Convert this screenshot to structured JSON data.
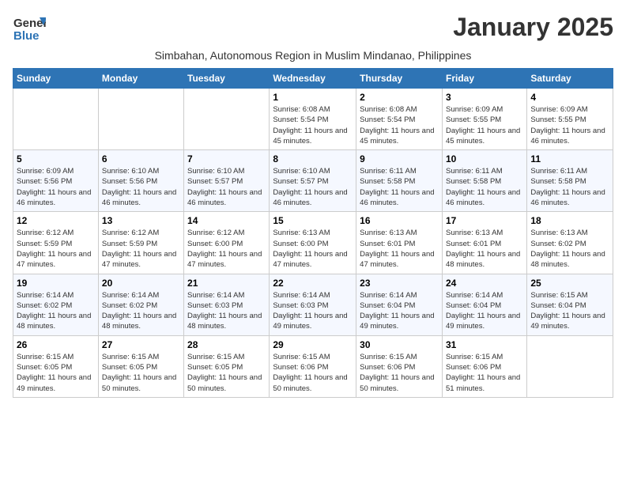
{
  "logo": {
    "general": "General",
    "blue": "Blue"
  },
  "title": "January 2025",
  "subtitle": "Simbahan, Autonomous Region in Muslim Mindanao, Philippines",
  "days_of_week": [
    "Sunday",
    "Monday",
    "Tuesday",
    "Wednesday",
    "Thursday",
    "Friday",
    "Saturday"
  ],
  "weeks": [
    [
      {
        "day": "",
        "info": ""
      },
      {
        "day": "",
        "info": ""
      },
      {
        "day": "",
        "info": ""
      },
      {
        "day": "1",
        "info": "Sunrise: 6:08 AM\nSunset: 5:54 PM\nDaylight: 11 hours and 45 minutes."
      },
      {
        "day": "2",
        "info": "Sunrise: 6:08 AM\nSunset: 5:54 PM\nDaylight: 11 hours and 45 minutes."
      },
      {
        "day": "3",
        "info": "Sunrise: 6:09 AM\nSunset: 5:55 PM\nDaylight: 11 hours and 45 minutes."
      },
      {
        "day": "4",
        "info": "Sunrise: 6:09 AM\nSunset: 5:55 PM\nDaylight: 11 hours and 46 minutes."
      }
    ],
    [
      {
        "day": "5",
        "info": "Sunrise: 6:09 AM\nSunset: 5:56 PM\nDaylight: 11 hours and 46 minutes."
      },
      {
        "day": "6",
        "info": "Sunrise: 6:10 AM\nSunset: 5:56 PM\nDaylight: 11 hours and 46 minutes."
      },
      {
        "day": "7",
        "info": "Sunrise: 6:10 AM\nSunset: 5:57 PM\nDaylight: 11 hours and 46 minutes."
      },
      {
        "day": "8",
        "info": "Sunrise: 6:10 AM\nSunset: 5:57 PM\nDaylight: 11 hours and 46 minutes."
      },
      {
        "day": "9",
        "info": "Sunrise: 6:11 AM\nSunset: 5:58 PM\nDaylight: 11 hours and 46 minutes."
      },
      {
        "day": "10",
        "info": "Sunrise: 6:11 AM\nSunset: 5:58 PM\nDaylight: 11 hours and 46 minutes."
      },
      {
        "day": "11",
        "info": "Sunrise: 6:11 AM\nSunset: 5:58 PM\nDaylight: 11 hours and 46 minutes."
      }
    ],
    [
      {
        "day": "12",
        "info": "Sunrise: 6:12 AM\nSunset: 5:59 PM\nDaylight: 11 hours and 47 minutes."
      },
      {
        "day": "13",
        "info": "Sunrise: 6:12 AM\nSunset: 5:59 PM\nDaylight: 11 hours and 47 minutes."
      },
      {
        "day": "14",
        "info": "Sunrise: 6:12 AM\nSunset: 6:00 PM\nDaylight: 11 hours and 47 minutes."
      },
      {
        "day": "15",
        "info": "Sunrise: 6:13 AM\nSunset: 6:00 PM\nDaylight: 11 hours and 47 minutes."
      },
      {
        "day": "16",
        "info": "Sunrise: 6:13 AM\nSunset: 6:01 PM\nDaylight: 11 hours and 47 minutes."
      },
      {
        "day": "17",
        "info": "Sunrise: 6:13 AM\nSunset: 6:01 PM\nDaylight: 11 hours and 48 minutes."
      },
      {
        "day": "18",
        "info": "Sunrise: 6:13 AM\nSunset: 6:02 PM\nDaylight: 11 hours and 48 minutes."
      }
    ],
    [
      {
        "day": "19",
        "info": "Sunrise: 6:14 AM\nSunset: 6:02 PM\nDaylight: 11 hours and 48 minutes."
      },
      {
        "day": "20",
        "info": "Sunrise: 6:14 AM\nSunset: 6:02 PM\nDaylight: 11 hours and 48 minutes."
      },
      {
        "day": "21",
        "info": "Sunrise: 6:14 AM\nSunset: 6:03 PM\nDaylight: 11 hours and 48 minutes."
      },
      {
        "day": "22",
        "info": "Sunrise: 6:14 AM\nSunset: 6:03 PM\nDaylight: 11 hours and 49 minutes."
      },
      {
        "day": "23",
        "info": "Sunrise: 6:14 AM\nSunset: 6:04 PM\nDaylight: 11 hours and 49 minutes."
      },
      {
        "day": "24",
        "info": "Sunrise: 6:14 AM\nSunset: 6:04 PM\nDaylight: 11 hours and 49 minutes."
      },
      {
        "day": "25",
        "info": "Sunrise: 6:15 AM\nSunset: 6:04 PM\nDaylight: 11 hours and 49 minutes."
      }
    ],
    [
      {
        "day": "26",
        "info": "Sunrise: 6:15 AM\nSunset: 6:05 PM\nDaylight: 11 hours and 49 minutes."
      },
      {
        "day": "27",
        "info": "Sunrise: 6:15 AM\nSunset: 6:05 PM\nDaylight: 11 hours and 50 minutes."
      },
      {
        "day": "28",
        "info": "Sunrise: 6:15 AM\nSunset: 6:05 PM\nDaylight: 11 hours and 50 minutes."
      },
      {
        "day": "29",
        "info": "Sunrise: 6:15 AM\nSunset: 6:06 PM\nDaylight: 11 hours and 50 minutes."
      },
      {
        "day": "30",
        "info": "Sunrise: 6:15 AM\nSunset: 6:06 PM\nDaylight: 11 hours and 50 minutes."
      },
      {
        "day": "31",
        "info": "Sunrise: 6:15 AM\nSunset: 6:06 PM\nDaylight: 11 hours and 51 minutes."
      },
      {
        "day": "",
        "info": ""
      }
    ]
  ]
}
